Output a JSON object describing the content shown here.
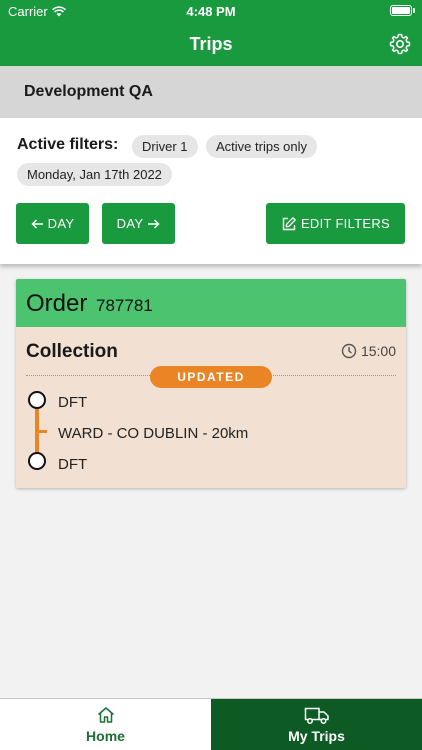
{
  "status_bar": {
    "carrier": "Carrier",
    "time": "4:48 PM"
  },
  "nav": {
    "title": "Trips",
    "settings_icon": "gear-icon"
  },
  "organization": "Development QA",
  "filters": {
    "label": "Active filters:",
    "chips": [
      "Driver 1",
      "Active trips only",
      "Monday, Jan 17th 2022"
    ],
    "prev_day": "DAY",
    "next_day": "DAY",
    "edit": "EDIT FILTERS"
  },
  "trip": {
    "order_label": "Order",
    "order_number": "787781",
    "type": "Collection",
    "time": "15:00",
    "badge": "UPDATED",
    "route": {
      "start": "DFT",
      "via": "WARD - CO DUBLIN - 20km",
      "end": "DFT"
    }
  },
  "tabs": [
    {
      "label": "Home",
      "icon": "home-icon",
      "active": false
    },
    {
      "label": "My Trips",
      "icon": "truck-icon",
      "active": true
    }
  ],
  "colors": {
    "primary": "#1a9a3e",
    "header": "#4cc36f",
    "card": "#f2e1d3",
    "accent": "#ea8526",
    "tab_active": "#0d5a25"
  }
}
